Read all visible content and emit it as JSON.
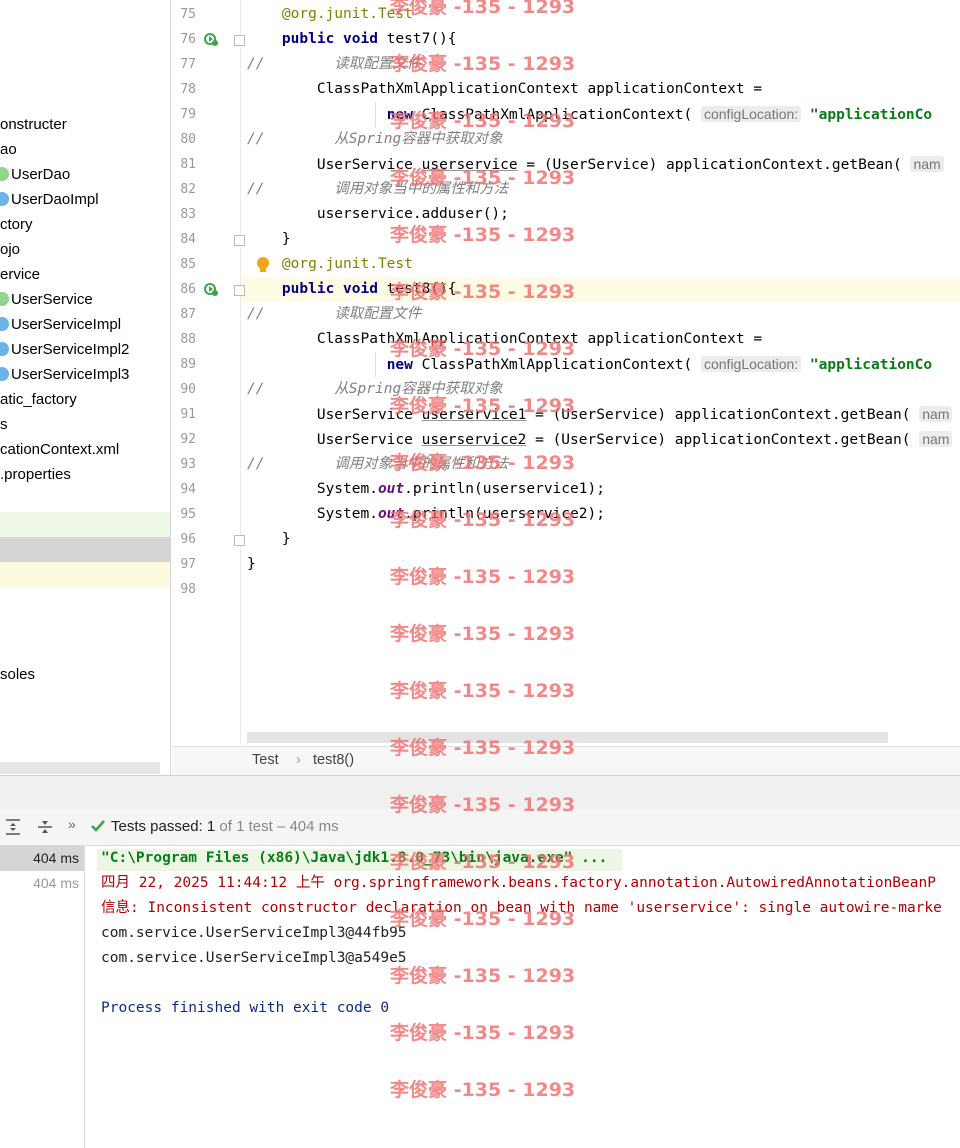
{
  "project_tree": {
    "items": [
      {
        "label": "onstructer",
        "icon": "folder"
      },
      {
        "label": "ao",
        "icon": "folder"
      },
      {
        "label": "UserDao",
        "icon": "interface-icon"
      },
      {
        "label": "UserDaoImpl",
        "icon": "class-icon"
      },
      {
        "label": "ctory",
        "icon": "folder"
      },
      {
        "label": "ojo",
        "icon": "folder"
      },
      {
        "label": "ervice",
        "icon": "folder"
      },
      {
        "label": "UserService",
        "icon": "interface-icon"
      },
      {
        "label": "UserServiceImpl",
        "icon": "class-icon"
      },
      {
        "label": "UserServiceImpl2",
        "icon": "class-icon"
      },
      {
        "label": "UserServiceImpl3",
        "icon": "class-icon"
      },
      {
        "label": "atic_factory",
        "icon": "folder"
      },
      {
        "label": "s",
        "icon": "folder"
      },
      {
        "label": "cationContext.xml",
        "icon": "xml"
      },
      {
        "label": ".properties",
        "icon": "properties"
      }
    ],
    "consoles_label": "soles"
  },
  "editor": {
    "lines": [
      {
        "n": "75",
        "segs": [
          [
            "    ",
            ""
          ],
          [
            "@org.junit.",
            "ann"
          ],
          [
            "Test",
            "ann"
          ]
        ]
      },
      {
        "n": "76",
        "segs": [
          [
            "    ",
            ""
          ],
          [
            "public void",
            "kw"
          ],
          [
            " test7(){",
            ""
          ]
        ]
      },
      {
        "n": "77",
        "segs": [
          [
            "//",
            "cmt"
          ],
          [
            "        读取配置文件",
            "cmt"
          ]
        ]
      },
      {
        "n": "78",
        "segs": [
          [
            "        ClassPathXmlApplicationContext applicationContext =",
            ""
          ]
        ]
      },
      {
        "n": "79",
        "segs": [
          [
            "                ",
            ""
          ],
          [
            "new",
            "kw"
          ],
          [
            " ClassPathXmlApplicationContext( ",
            ""
          ],
          [
            "configLocation:",
            "hint"
          ],
          [
            " ",
            ""
          ],
          [
            "\"applicationCo",
            "str"
          ]
        ]
      },
      {
        "n": "80",
        "segs": [
          [
            "//",
            "cmt"
          ],
          [
            "        从Spring容器中获取对象",
            "cmt"
          ]
        ]
      },
      {
        "n": "81",
        "segs": [
          [
            "        UserService ",
            ""
          ],
          [
            "userservice",
            "und"
          ],
          [
            " = (UserService) applicationContext.getBean( ",
            ""
          ],
          [
            "nam",
            "hint"
          ]
        ]
      },
      {
        "n": "82",
        "segs": [
          [
            "//",
            "cmt"
          ],
          [
            "        调用对象当中的属性和方法",
            "cmt"
          ]
        ]
      },
      {
        "n": "83",
        "segs": [
          [
            "        userservice.adduser();",
            ""
          ]
        ]
      },
      {
        "n": "84",
        "segs": [
          [
            "    }",
            ""
          ]
        ]
      },
      {
        "n": "85",
        "segs": [
          [
            "    ",
            ""
          ],
          [
            "@org.junit.",
            "ann"
          ],
          [
            "Test",
            "ann"
          ]
        ]
      },
      {
        "n": "86",
        "segs": [
          [
            "    ",
            ""
          ],
          [
            "public void",
            "kw"
          ],
          [
            " test8(){",
            ""
          ]
        ]
      },
      {
        "n": "87",
        "segs": [
          [
            "//",
            "cmt"
          ],
          [
            "        读取配置文件",
            "cmt"
          ]
        ]
      },
      {
        "n": "88",
        "segs": [
          [
            "        ClassPathXmlApplicationContext applicationContext =",
            ""
          ]
        ]
      },
      {
        "n": "89",
        "segs": [
          [
            "                ",
            ""
          ],
          [
            "new",
            "kw"
          ],
          [
            " ClassPathXmlApplicationContext( ",
            ""
          ],
          [
            "configLocation:",
            "hint"
          ],
          [
            " ",
            ""
          ],
          [
            "\"applicationCo",
            "str"
          ]
        ]
      },
      {
        "n": "90",
        "segs": [
          [
            "//",
            "cmt"
          ],
          [
            "        从Spring容器中获取对象",
            "cmt"
          ]
        ]
      },
      {
        "n": "91",
        "segs": [
          [
            "        UserService ",
            ""
          ],
          [
            "userservice1",
            "und"
          ],
          [
            " = (UserService) applicationContext.getBean( ",
            ""
          ],
          [
            "nam",
            "hint"
          ]
        ]
      },
      {
        "n": "92",
        "segs": [
          [
            "        UserService ",
            ""
          ],
          [
            "userservice2",
            "und"
          ],
          [
            " = (UserService) applicationContext.getBean( ",
            ""
          ],
          [
            "nam",
            "hint"
          ]
        ]
      },
      {
        "n": "93",
        "segs": [
          [
            "//",
            "cmt"
          ],
          [
            "        调用对象当中的属性和方法",
            "cmt"
          ]
        ]
      },
      {
        "n": "94",
        "segs": [
          [
            "        System.",
            ""
          ],
          [
            "out",
            "fld"
          ],
          [
            ".println(userservice1);",
            ""
          ]
        ]
      },
      {
        "n": "95",
        "segs": [
          [
            "        System.",
            ""
          ],
          [
            "out",
            "fld"
          ],
          [
            ".println(userservice2);",
            ""
          ]
        ]
      },
      {
        "n": "96",
        "segs": [
          [
            "    }",
            ""
          ]
        ]
      },
      {
        "n": "97",
        "segs": [
          [
            "}",
            ""
          ]
        ]
      },
      {
        "n": "98",
        "segs": [
          [
            "",
            ""
          ]
        ]
      }
    ]
  },
  "breadcrumb": {
    "class_name": "Test",
    "separator": "›",
    "method": "test8()"
  },
  "run": {
    "status_prefix": "Tests passed:",
    "passed": "1",
    "status_suffix": "of 1 test – 404 ms",
    "tree_rows": [
      {
        "time": "404 ms",
        "selected": true
      },
      {
        "time": "404 ms",
        "selected": false
      }
    ],
    "console": [
      {
        "text": "\"C:\\Program Files (x86)\\Java\\jdk1.8.0_73\\bin\\java.exe\" ...",
        "style": "cmd"
      },
      {
        "text": "四月 22, 2025 11:44:12 上午 org.springframework.beans.factory.annotation.AutowiredAnnotationBeanP",
        "style": "err"
      },
      {
        "text": "信息: Inconsistent constructor declaration on bean with name 'userservice': single autowire-marke",
        "style": "err"
      },
      {
        "text": "com.service.UserServiceImpl3@44fb95",
        "style": "out"
      },
      {
        "text": "com.service.UserServiceImpl3@a549e5",
        "style": "out"
      },
      {
        "text": "",
        "style": "out"
      },
      {
        "text": "Process finished with exit code 0",
        "style": "exit"
      }
    ]
  },
  "watermark": {
    "text": "李俊豪 -135 - 1293"
  },
  "colors": {
    "keyword": "#000080",
    "annotation": "#808000",
    "comment": "#808080",
    "string": "#067d17",
    "console_error": "#b00000",
    "exit": "#0a2a8a",
    "pass": "#3aa64a"
  }
}
